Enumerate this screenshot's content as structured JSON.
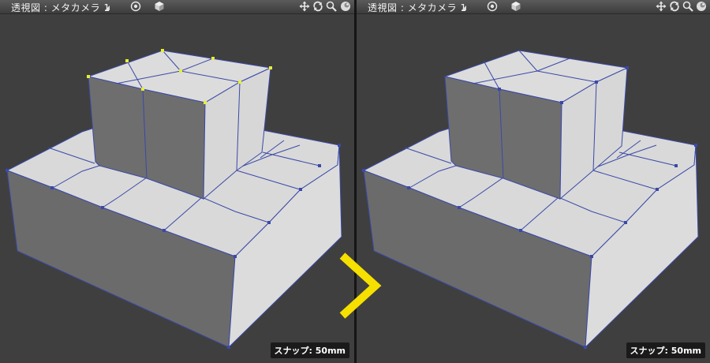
{
  "viewports": [
    {
      "title": "透視図 : メタカメラ 1",
      "snap": "スナップ: 50mm",
      "selected_vertices": true
    },
    {
      "title": "透視図 : メタカメラ 1",
      "snap": "スナップ: 50mm",
      "selected_vertices": false
    }
  ],
  "toolbar_icons": [
    "camera-target-icon",
    "cube-view-icon",
    "move-view-icon",
    "rotate-view-icon",
    "zoom-view-icon",
    "display-mode-icon"
  ],
  "colors": {
    "accent_arrow": "#f5e000",
    "selected_vertex": "#e8ef30",
    "edge": "#3a49a8"
  }
}
